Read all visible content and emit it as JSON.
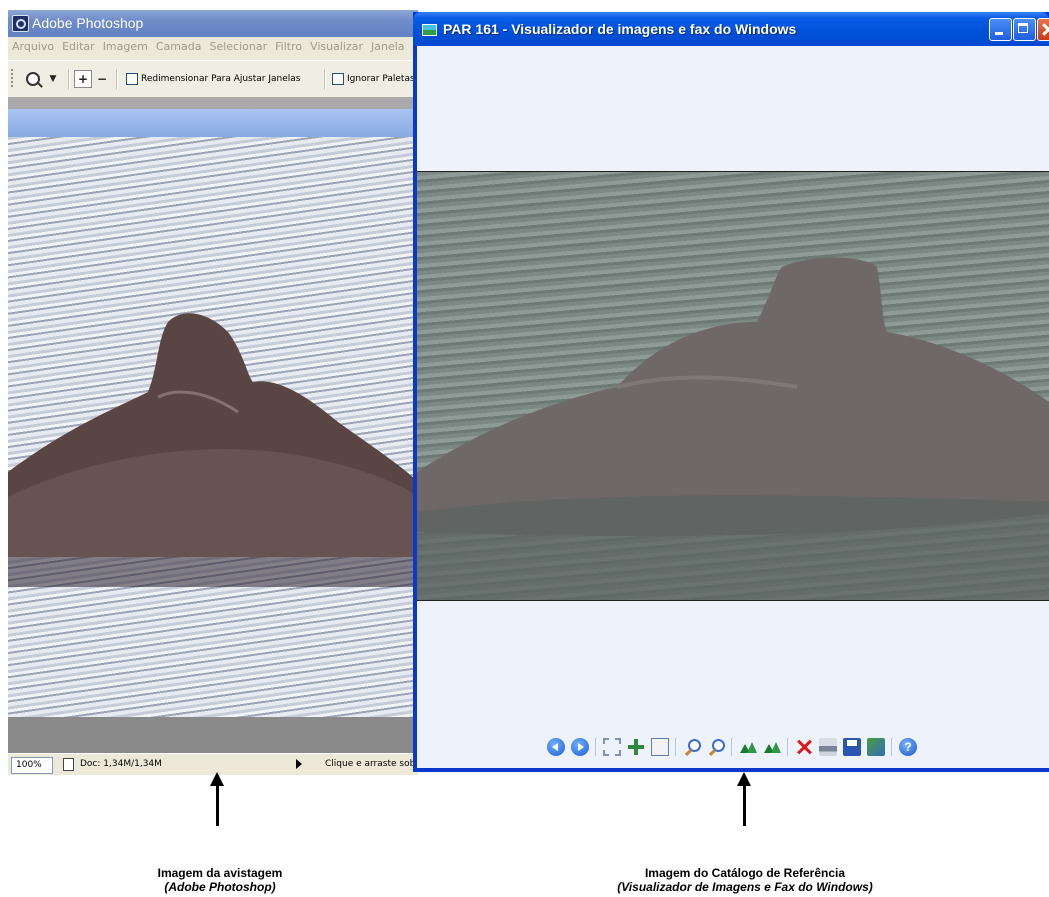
{
  "photoshop": {
    "title": "Adobe Photoshop",
    "menu": [
      "Arquivo",
      "Editar",
      "Imagem",
      "Camada",
      "Selecionar",
      "Filtro",
      "Visualizar",
      "Janela"
    ],
    "toolbar": {
      "resize_label": "Redimensionar Para Ajustar Janelas",
      "ignore_label": "Ignorar Paletas"
    },
    "status": {
      "zoom": "100%",
      "doc": "Doc: 1,34M/1,34M",
      "hint": "Clique e arraste sob"
    }
  },
  "viewer": {
    "title": "PAR 161 - Visualizador de imagens e fax do Windows",
    "toolbar_icons": [
      "previous-image-icon",
      "next-image-icon",
      "best-fit-icon",
      "actual-size-icon",
      "slideshow-icon",
      "zoom-in-icon",
      "zoom-out-icon",
      "rotate-clockwise-icon",
      "rotate-counterclockwise-icon",
      "delete-icon",
      "print-icon",
      "save-icon",
      "edit-icon",
      "help-icon"
    ]
  },
  "captions": {
    "left_title": "Imagem da avistagem",
    "left_sub": "(Adobe Photoshop)",
    "right_title": "Imagem do Catálogo de Referência",
    "right_sub": "(Visualizador de Imagens e Fax do Windows)"
  },
  "colors": {
    "xp_title_blue": "#0051d8",
    "xp_close_red": "#c83a1a",
    "photoshop_face": "#ece9d8"
  }
}
